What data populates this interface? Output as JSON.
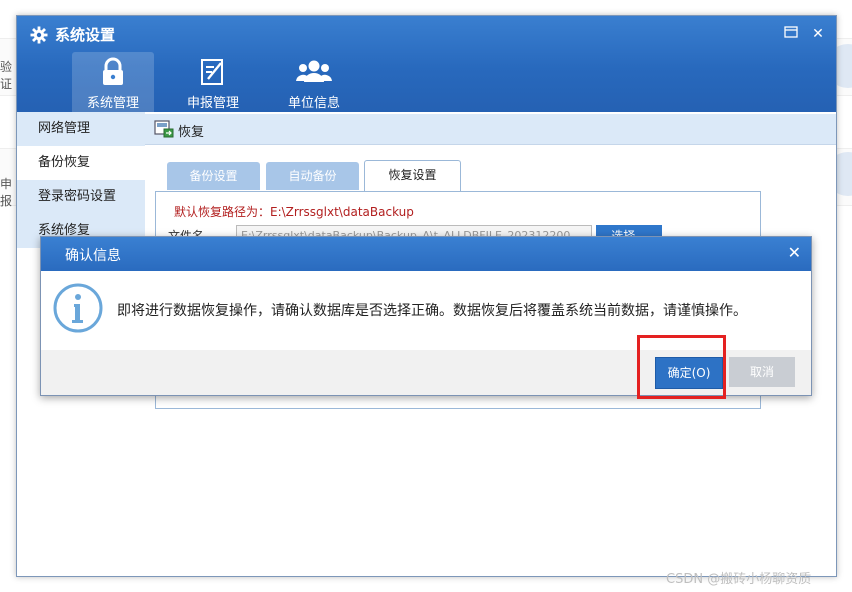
{
  "background": {
    "left_labels": [
      "验证",
      "申报"
    ]
  },
  "window": {
    "title": "系统设置",
    "nav_tabs": [
      {
        "label": "系统管理",
        "icon": "lock-icon",
        "active": true
      },
      {
        "label": "申报管理",
        "icon": "document-edit-icon",
        "active": false
      },
      {
        "label": "单位信息",
        "icon": "users-icon",
        "active": false
      }
    ],
    "sidebar_items": [
      "网络管理",
      "备份恢复",
      "登录密码设置",
      "系统修复"
    ],
    "content_header": "恢复",
    "sub_tabs": [
      "备份设置",
      "自动备份",
      "恢复设置"
    ],
    "default_path_text": "默认恢复路径为：E:\\Zrrssglxt\\dataBackup",
    "file_label": "文件名",
    "file_value": "E:\\Zrrssglxt\\dataBackup\\Backup_A\\t_ALLDBFILE_202312200",
    "browse_label": "选择..."
  },
  "dialog": {
    "title": "确认信息",
    "message": "即将进行数据恢复操作，请确认数据库是否选择正确。数据恢复后将覆盖系统当前数据，请谨慎操作。",
    "ok_label": "确定(O)",
    "cancel_label": "取消"
  },
  "watermark": "CSDN @搬砖小杨聊资质",
  "colors": {
    "titlebar": "#2a6bbf",
    "accent": "#2d72c5",
    "highlight": "#e42121",
    "sidebar_bg": "#dbe9f8",
    "path_text": "#b21f1f"
  }
}
